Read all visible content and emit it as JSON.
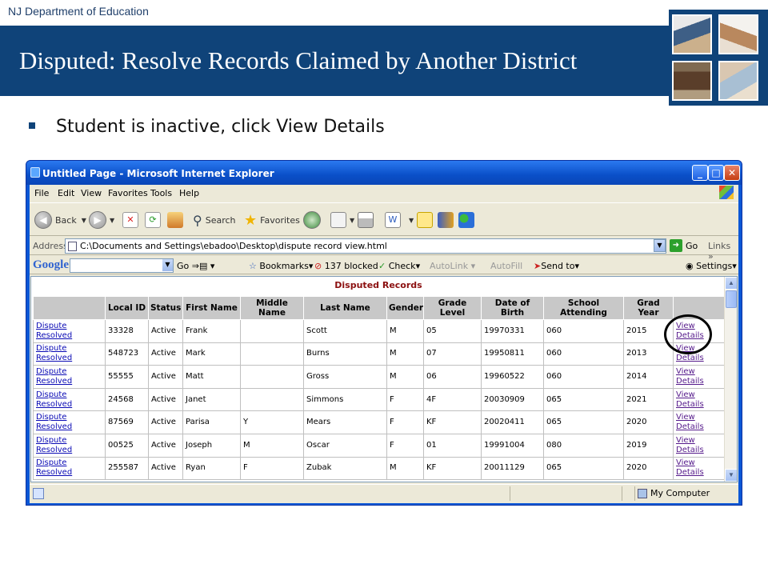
{
  "slide": {
    "org_label": "NJ Department of Education",
    "title": "Disputed: Resolve Records Claimed by Another District",
    "bullet": "Student is inactive, click View Details",
    "brand_color": "#0f4379"
  },
  "browser": {
    "window_title": "Untitled Page - Microsoft Internet Explorer",
    "window_buttons": [
      "_",
      "□",
      "✕"
    ],
    "menu": [
      "File",
      "Edit",
      "View",
      "Favorites",
      "Tools",
      "Help"
    ],
    "toolbar": {
      "back": "Back",
      "search": "Search",
      "favorites": "Favorites"
    },
    "address": {
      "label": "Address",
      "url": "C:\\Documents and Settings\\ebadoo\\Desktop\\dispute record view.html",
      "go": "Go",
      "links": "Links"
    },
    "google_bar": {
      "logo": "Google",
      "go": "Go",
      "bookmarks": "Bookmarks",
      "blocked": "137 blocked",
      "check": "Check",
      "autolink": "AutoLink",
      "autofill": "AutoFill",
      "send_to": "Send to",
      "settings": "Settings"
    },
    "status": {
      "zone": "My Computer"
    }
  },
  "report": {
    "title": "Disputed Records",
    "columns": [
      "",
      "Local ID",
      "Status",
      "First Name",
      "Middle Name",
      "Last Name",
      "Gender",
      "Grade Level",
      "Date of Birth",
      "School Attending",
      "Grad Year",
      ""
    ],
    "rows": [
      {
        "action": "Dispute Resolved",
        "local_id": "33328",
        "status": "Active",
        "first": "Frank",
        "middle": "",
        "last": "Scott",
        "gender": "M",
        "grade": "05",
        "dob": "19970331",
        "school": "060",
        "grad": "2015",
        "link": "View Details"
      },
      {
        "action": "Dispute Resolved",
        "local_id": "548723",
        "status": "Active",
        "first": "Mark",
        "middle": "",
        "last": "Burns",
        "gender": "M",
        "grade": "07",
        "dob": "19950811",
        "school": "060",
        "grad": "2013",
        "link": "View Details"
      },
      {
        "action": "Dispute Resolved",
        "local_id": "55555",
        "status": "Active",
        "first": "Matt",
        "middle": "",
        "last": "Gross",
        "gender": "M",
        "grade": "06",
        "dob": "19960522",
        "school": "060",
        "grad": "2014",
        "link": "View Details"
      },
      {
        "action": "Dispute Resolved",
        "local_id": "24568",
        "status": "Active",
        "first": "Janet",
        "middle": "",
        "last": "Simmons",
        "gender": "F",
        "grade": "4F",
        "dob": "20030909",
        "school": "065",
        "grad": "2021",
        "link": "View Details"
      },
      {
        "action": "Dispute Resolved",
        "local_id": "87569",
        "status": "Active",
        "first": "Parisa",
        "middle": "Y",
        "last": "Mears",
        "gender": "F",
        "grade": "KF",
        "dob": "20020411",
        "school": "065",
        "grad": "2020",
        "link": "View Details"
      },
      {
        "action": "Dispute Resolved",
        "local_id": "00525",
        "status": "Active",
        "first": "Joseph",
        "middle": "M",
        "last": "Oscar",
        "gender": "F",
        "grade": "01",
        "dob": "19991004",
        "school": "080",
        "grad": "2019",
        "link": "View Details"
      },
      {
        "action": "Dispute Resolved",
        "local_id": "255587",
        "status": "Active",
        "first": "Ryan",
        "middle": "F",
        "last": "Zubak",
        "gender": "M",
        "grade": "KF",
        "dob": "20011129",
        "school": "065",
        "grad": "2020",
        "link": "View Details"
      }
    ]
  }
}
